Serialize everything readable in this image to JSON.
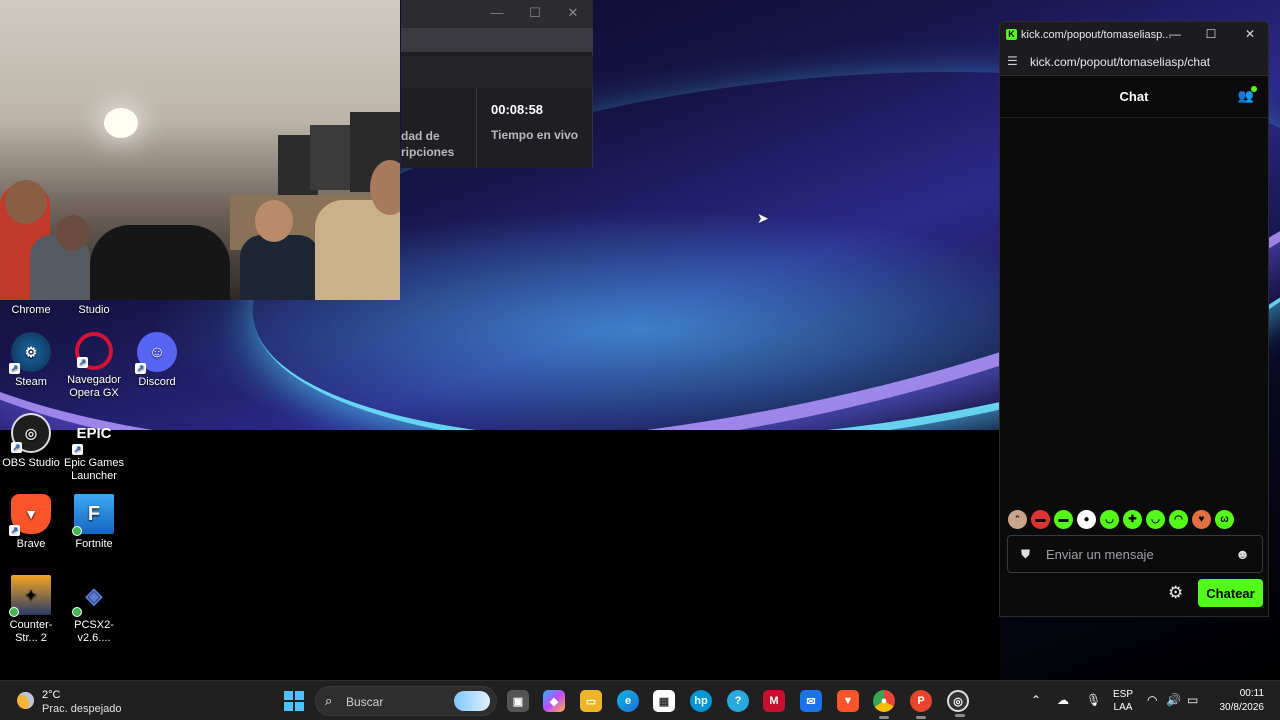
{
  "stats_window": {
    "left_label": "dad de\nripciones",
    "live_time": "00:08:58",
    "live_label": "Tiempo en vivo"
  },
  "desktop": {
    "icons": [
      {
        "label": "Chrome",
        "icon": "chrome-icon"
      },
      {
        "label": "Studio",
        "icon": "studio-icon"
      },
      {
        "label": "Steam",
        "icon": "steam-icon"
      },
      {
        "label": "Navegador Opera GX",
        "icon": "opera-gx-icon"
      },
      {
        "label": "Discord",
        "icon": "discord-icon"
      },
      {
        "label": "OBS Studio",
        "icon": "obs-icon"
      },
      {
        "label": "Epic Games Launcher",
        "icon": "epic-games-icon"
      },
      {
        "label": "Brave",
        "icon": "brave-icon"
      },
      {
        "label": "Fortnite",
        "icon": "fortnite-icon"
      },
      {
        "label": "Counter-Str... 2",
        "icon": "counter-strike-icon"
      },
      {
        "label": "PCSX2-v2.6....",
        "icon": "pcsx2-icon"
      }
    ]
  },
  "chat_window": {
    "window_title": "kick.com/popout/tomaseliasp...",
    "url": "kick.com/popout/tomaseliasp/chat",
    "header_title": "Chat",
    "input_placeholder": "Enviar un mensaje",
    "send_label": "Chatear",
    "accent": "#53fc18",
    "emotes": [
      "cat-emote",
      "angry-emote",
      "green-emote",
      "panda-emote",
      "green-emote-2",
      "green-emote-3",
      "green-emote-4",
      "green-emote-5",
      "heart-emote",
      "green-emote-6"
    ]
  },
  "taskbar": {
    "weather_temp": "2°C",
    "weather_cond": "Prac. despejado",
    "search_placeholder": "Buscar",
    "lang_top": "ESP",
    "lang_bottom": "LAA",
    "time": "00:11",
    "date": "30/8/2026"
  }
}
